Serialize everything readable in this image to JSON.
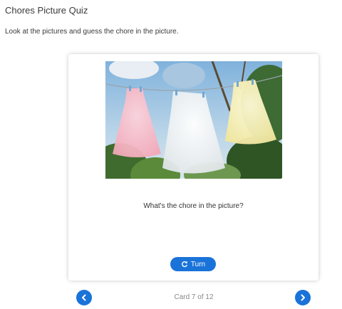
{
  "page": {
    "title": "Chores Picture Quiz",
    "instructions": "Look at the pictures and guess the chore in the picture."
  },
  "card": {
    "image_icon": "laundry-clothesline-photo",
    "question": "What's the chore in the picture?",
    "turn_label": "Turn",
    "turn_icon": "refresh-icon"
  },
  "navigation": {
    "prev_icon": "chevron-left-icon",
    "next_icon": "chevron-right-icon",
    "counter": "Card 7 of 12"
  },
  "colors": {
    "accent": "#1a73d9"
  }
}
